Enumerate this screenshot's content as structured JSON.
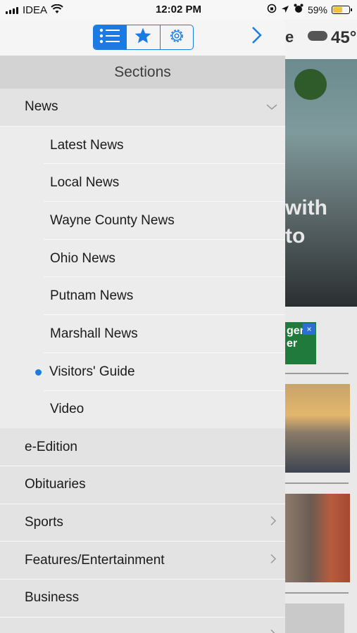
{
  "status": {
    "carrier": "IDEA",
    "time": "12:02 PM",
    "battery": "59%",
    "battery_level": 0.59,
    "accent": "#1c7be3"
  },
  "toolbar": {
    "segments": [
      {
        "icon": "list-icon",
        "active": true
      },
      {
        "icon": "star-icon",
        "active": false
      },
      {
        "icon": "gear-icon",
        "active": false
      }
    ],
    "forward_icon": "chevron-right-icon"
  },
  "drawer": {
    "title": "Sections",
    "news": {
      "label": "News",
      "expanded": true,
      "items": [
        {
          "label": "Latest News"
        },
        {
          "label": "Local News"
        },
        {
          "label": "Wayne County News"
        },
        {
          "label": "Ohio News"
        },
        {
          "label": "Putnam News"
        },
        {
          "label": "Marshall News"
        },
        {
          "label": "Visitors' Guide",
          "selected": true
        },
        {
          "label": "Video"
        }
      ]
    },
    "sections": [
      {
        "label": "e-Edition",
        "has_children": false
      },
      {
        "label": "Obituaries",
        "has_children": false
      },
      {
        "label": "Sports",
        "has_children": true
      },
      {
        "label": "Features/Entertainment",
        "has_children": true
      },
      {
        "label": "Business",
        "has_children": false
      }
    ]
  },
  "background": {
    "weather_temp": "45°",
    "weather_suffix": "e",
    "hero_text_1": "with",
    "hero_text_2": "to",
    "ad_text": "gent er"
  }
}
